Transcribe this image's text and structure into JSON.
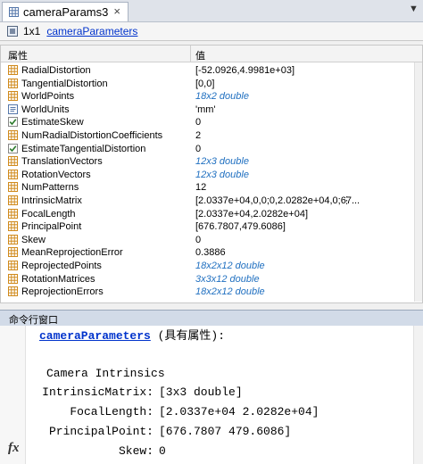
{
  "editor_tab": {
    "label": "cameraParams3",
    "close_glyph": "×",
    "overflow_glyph": "▼"
  },
  "infobar": {
    "size": "1x1",
    "class_name": "cameraParameters"
  },
  "table": {
    "header_property": "属性",
    "header_value": "值",
    "rows": [
      {
        "icon": "grid-icon",
        "name": "RadialDistortion",
        "value": "[-52.0926,4.9981e+03]",
        "summary": false
      },
      {
        "icon": "grid-icon",
        "name": "TangentialDistortion",
        "value": "[0,0]",
        "summary": false
      },
      {
        "icon": "grid-icon",
        "name": "WorldPoints",
        "value": "18x2 double",
        "summary": true
      },
      {
        "icon": "text-icon",
        "name": "WorldUnits",
        "value": "'mm'",
        "summary": false
      },
      {
        "icon": "check-icon",
        "name": "EstimateSkew",
        "value": "0",
        "summary": false
      },
      {
        "icon": "grid-icon",
        "name": "NumRadialDistortionCoefficients",
        "value": "2",
        "summary": false
      },
      {
        "icon": "check-icon",
        "name": "EstimateTangentialDistortion",
        "value": "0",
        "summary": false
      },
      {
        "icon": "grid-icon",
        "name": "TranslationVectors",
        "value": "12x3 double",
        "summary": true
      },
      {
        "icon": "grid-icon",
        "name": "RotationVectors",
        "value": "12x3 double",
        "summary": true
      },
      {
        "icon": "grid-icon",
        "name": "NumPatterns",
        "value": "12",
        "summary": false
      },
      {
        "icon": "grid-icon",
        "name": "IntrinsicMatrix",
        "value": "[2.0337e+04,0,0;0,2.0282e+04,0;67...",
        "summary": false,
        "menu": "⋮"
      },
      {
        "icon": "grid-icon",
        "name": "FocalLength",
        "value": "[2.0337e+04,2.0282e+04]",
        "summary": false
      },
      {
        "icon": "grid-icon",
        "name": "PrincipalPoint",
        "value": "[676.7807,479.6086]",
        "summary": false
      },
      {
        "icon": "grid-icon",
        "name": "Skew",
        "value": "0",
        "summary": false
      },
      {
        "icon": "grid-icon",
        "name": "MeanReprojectionError",
        "value": "0.3886",
        "summary": false
      },
      {
        "icon": "grid-icon",
        "name": "ReprojectedPoints",
        "value": "18x2x12 double",
        "summary": true
      },
      {
        "icon": "grid-icon",
        "name": "RotationMatrices",
        "value": "3x3x12 double",
        "summary": true
      },
      {
        "icon": "grid-icon",
        "name": "ReprojectionErrors",
        "value": "18x2x12 double",
        "summary": true
      }
    ]
  },
  "command_window": {
    "title": "命令行窗口",
    "class_link": "cameraParameters",
    "class_suffix": " (具有属性):",
    "section": "Camera Intrinsics",
    "lines": [
      {
        "label": "IntrinsicMatrix:",
        "value": "[3x3 double]"
      },
      {
        "label": "FocalLength:",
        "value": "[2.0337e+04 2.0282e+04]"
      },
      {
        "label": "PrincipalPoint:",
        "value": "[676.7807 479.6086]"
      },
      {
        "label": "Skew:",
        "value": "0"
      }
    ],
    "prompt_glyph": "fx"
  }
}
